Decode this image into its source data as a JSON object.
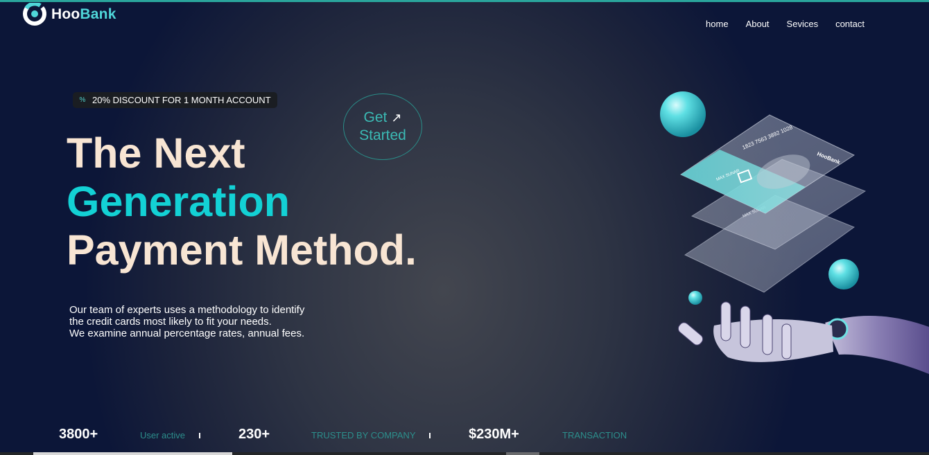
{
  "brand": {
    "name_part1": "Hoo",
    "name_part2": "Bank"
  },
  "nav": {
    "items": [
      "home",
      "About",
      "Sevices",
      "contact"
    ]
  },
  "promo": {
    "text": "20% DISCOUNT FOR 1 MONTH ACCOUNT",
    "icon": "discount-icon"
  },
  "cta": {
    "line1": "Get",
    "line2": "Started",
    "icon": "arrow-up-right-icon"
  },
  "headline": {
    "line1": "The Next",
    "line2": "Generation",
    "line3": "Payment Method."
  },
  "description": {
    "line1": "Our team of experts uses a methodology to identify",
    "line2": "the credit cards most likely to fit your needs.",
    "line3": "We examine annual percentage rates, annual fees."
  },
  "stats": [
    {
      "value": "3800+",
      "label": "User active"
    },
    {
      "value": "230+",
      "label": "TRUSTED BY COMPANY"
    },
    {
      "value": "$230M+",
      "label": "TRANSACTION"
    }
  ],
  "cards": {
    "card_number": "1823 7563 3892 1028",
    "card_name": "MAX SUNAR",
    "card_brand": "HooBank"
  },
  "colors": {
    "accent": "#13d1d5",
    "headline": "#f8e5d3",
    "muted_label": "#2c8f8c",
    "background": "#0b1535"
  }
}
